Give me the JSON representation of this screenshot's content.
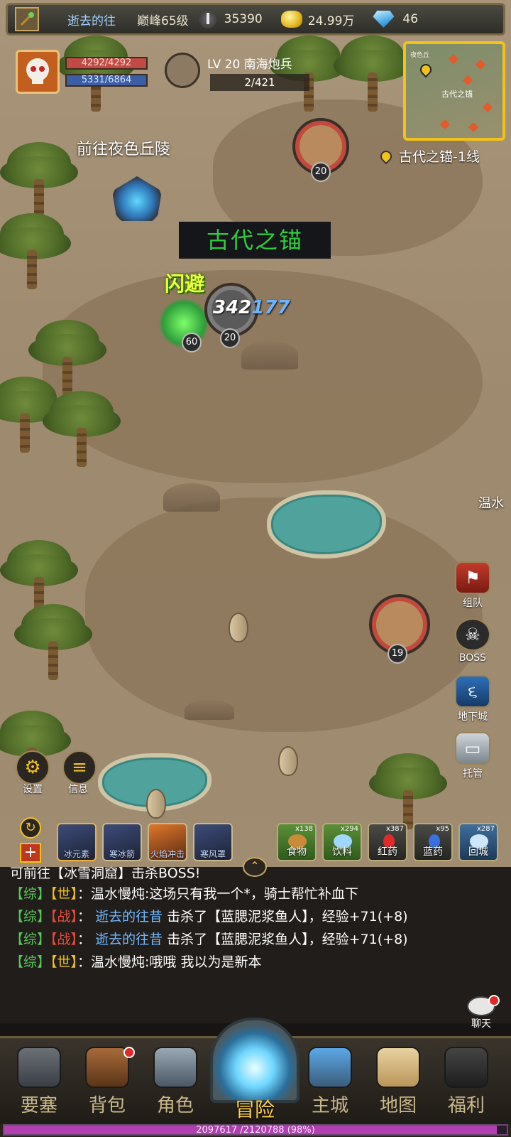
{
  "topbar": {
    "player_name": "逝去的往",
    "peak_level": "巅峰65级",
    "power": "35390",
    "gold": "24.99万",
    "diamonds": "46"
  },
  "player": {
    "hp": "4292/4292",
    "mp": "5331/6864"
  },
  "target": {
    "name": "LV 20 南海炮兵",
    "kill_count": "2/421"
  },
  "minimap": {
    "top_label": "夜色丘",
    "center_label": "古代之锚"
  },
  "map": {
    "zone_line": "古代之锚-1线",
    "goto_label": "前往夜色丘陵",
    "east_label": "温水",
    "area_banner": "古代之锚",
    "dodge_text": "闪避",
    "damage_white": "342",
    "damage_blue": "177",
    "units": [
      {
        "level": "20"
      },
      {
        "level": "60"
      },
      {
        "level": "20"
      },
      {
        "level": "19"
      }
    ]
  },
  "side_menu": [
    {
      "label": "组队",
      "icon": "team-flag-icon"
    },
    {
      "label": "BOSS",
      "icon": "skull-icon"
    },
    {
      "label": "地下城",
      "icon": "dungeon-swirl-icon"
    },
    {
      "label": "托管",
      "icon": "auto-monitor-icon"
    }
  ],
  "left_buttons": {
    "settings": "设置",
    "info": "信息"
  },
  "skills": [
    {
      "name": "冰元素"
    },
    {
      "name": "寒冰箭"
    },
    {
      "name": "火焰冲击"
    },
    {
      "name": "寒风罩"
    }
  ],
  "items": [
    {
      "name": "食物",
      "count": "x138"
    },
    {
      "name": "饮料",
      "count": "x294"
    },
    {
      "name": "红药",
      "count": "x387"
    },
    {
      "name": "蓝药",
      "count": "x95"
    },
    {
      "name": "回城",
      "count": "x287"
    }
  ],
  "chat": {
    "partial_line": "可前往【冰雪洞窟】击杀BOSS!",
    "messages": [
      {
        "ch": "【综】",
        "type": "【世】",
        "type_class": "tw",
        "name": "",
        "text": "：温水慢炖:这场只有我一个*，骑士帮忙补血下"
      },
      {
        "ch": "【综】",
        "type": "【战】",
        "type_class": "tz",
        "name": "逝去的往昔",
        "text": " 击杀了【蓝腮泥浆鱼人】，经验+71(+8)"
      },
      {
        "ch": "【综】",
        "type": "【战】",
        "type_class": "tz",
        "name": "逝去的往昔",
        "text": " 击杀了【蓝腮泥浆鱼人】，经验+71(+8)"
      },
      {
        "ch": "【综】",
        "type": "【世】",
        "type_class": "tw",
        "name": "",
        "text": "：温水慢炖:哦哦 我以为是新本"
      }
    ],
    "chat_button": "聊天"
  },
  "nav": [
    {
      "label": "要塞"
    },
    {
      "label": "背包"
    },
    {
      "label": "角色"
    },
    {
      "label": "冒险"
    },
    {
      "label": "主城"
    },
    {
      "label": "地图"
    },
    {
      "label": "福利"
    }
  ],
  "xp": {
    "text": "2097617 /2120788 (98%)",
    "fraction": 0.98
  }
}
